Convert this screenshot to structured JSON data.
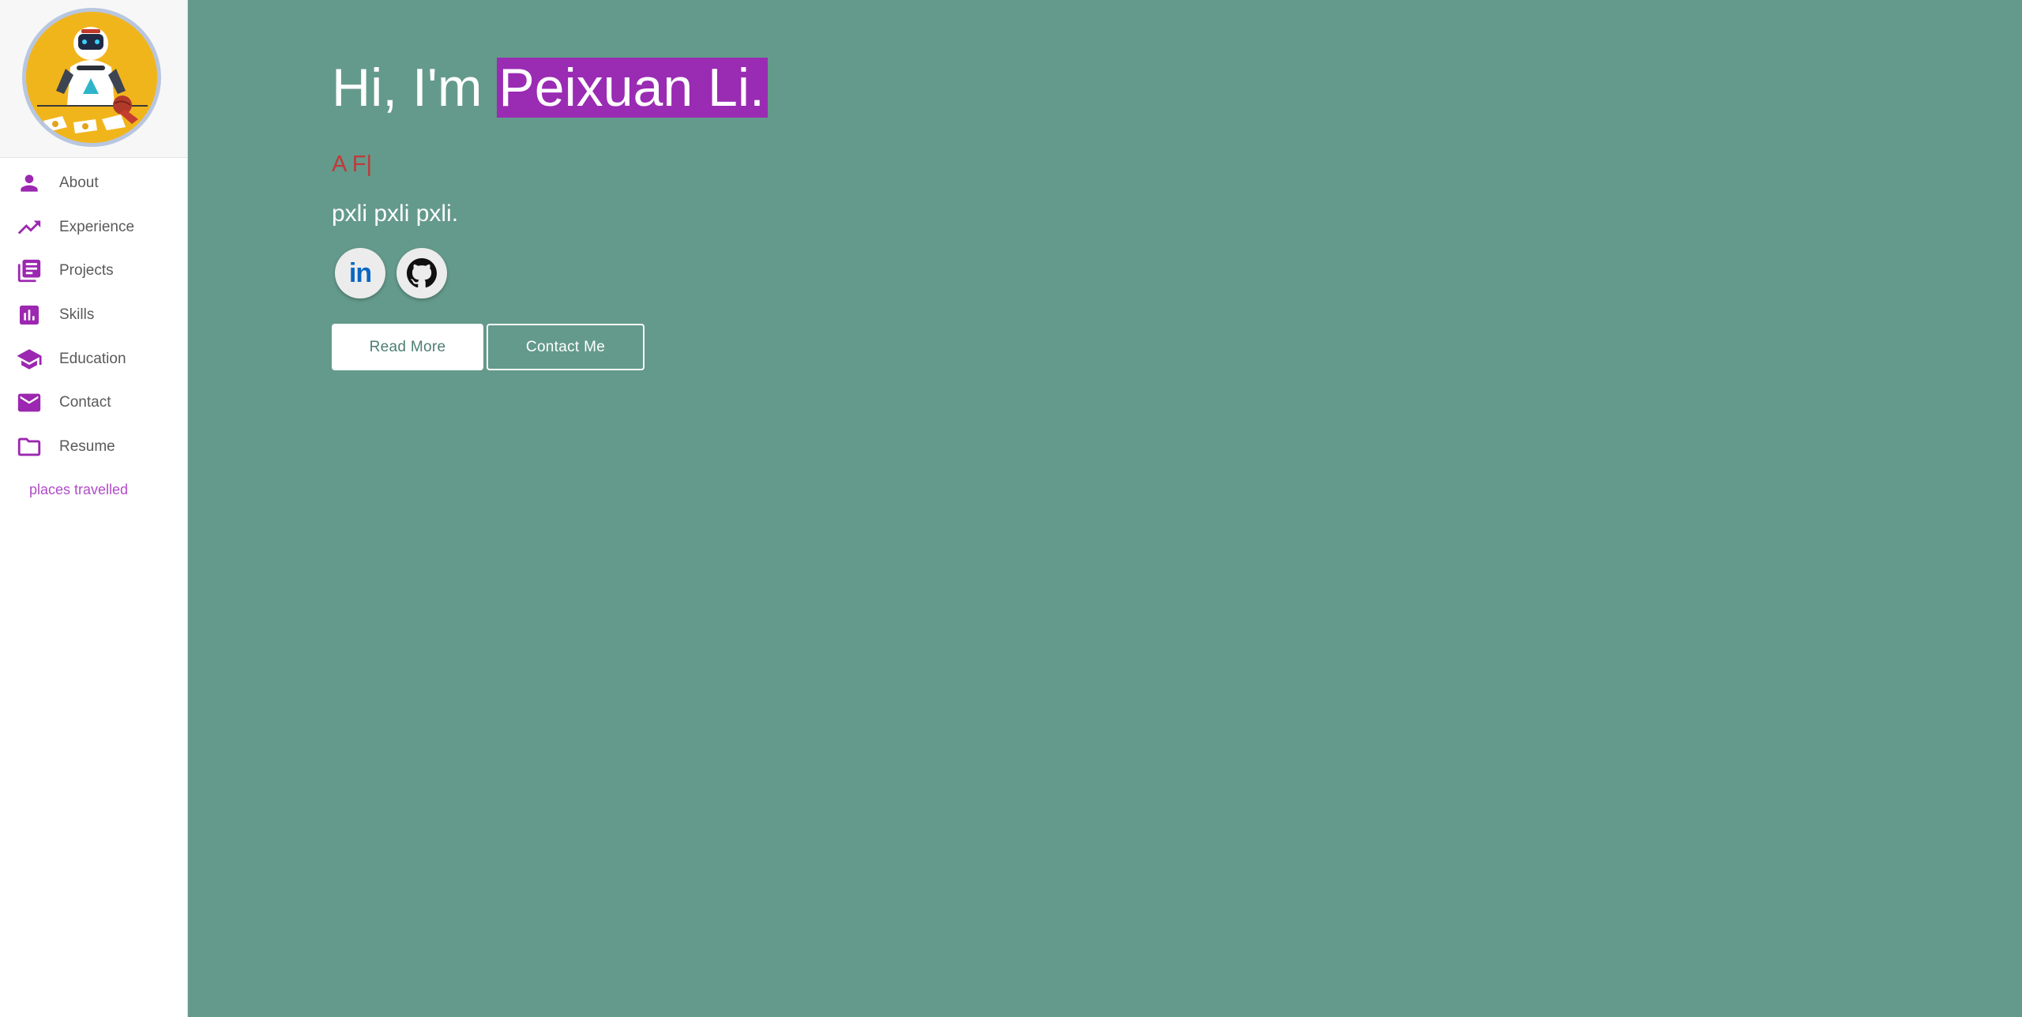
{
  "sidebar": {
    "items": [
      {
        "label": "About",
        "icon": "person-icon"
      },
      {
        "label": "Experience",
        "icon": "trending-up-icon"
      },
      {
        "label": "Projects",
        "icon": "library-books-icon"
      },
      {
        "label": "Skills",
        "icon": "bar-chart-icon"
      },
      {
        "label": "Education",
        "icon": "school-icon"
      },
      {
        "label": "Contact",
        "icon": "mail-icon"
      },
      {
        "label": "Resume",
        "icon": "folder-icon"
      }
    ],
    "extra_link": "places travelled"
  },
  "hero": {
    "greeting": "Hi, I'm ",
    "name": "Peixuan Li.",
    "typed_text": "A F",
    "typed_cursor": "|",
    "tagline": "pxli pxli pxli."
  },
  "social": [
    {
      "name": "LinkedIn",
      "icon": "linkedin-icon",
      "glyph": "in"
    },
    {
      "name": "GitHub",
      "icon": "github-icon"
    }
  ],
  "buttons": {
    "read_more": "Read More",
    "contact_me": "Contact Me"
  },
  "colors": {
    "accent": "#9c27b0",
    "background": "#649a8b",
    "sidebar": "#ffffff",
    "typed_text": "#c0393b",
    "link": "#b04bc8"
  }
}
